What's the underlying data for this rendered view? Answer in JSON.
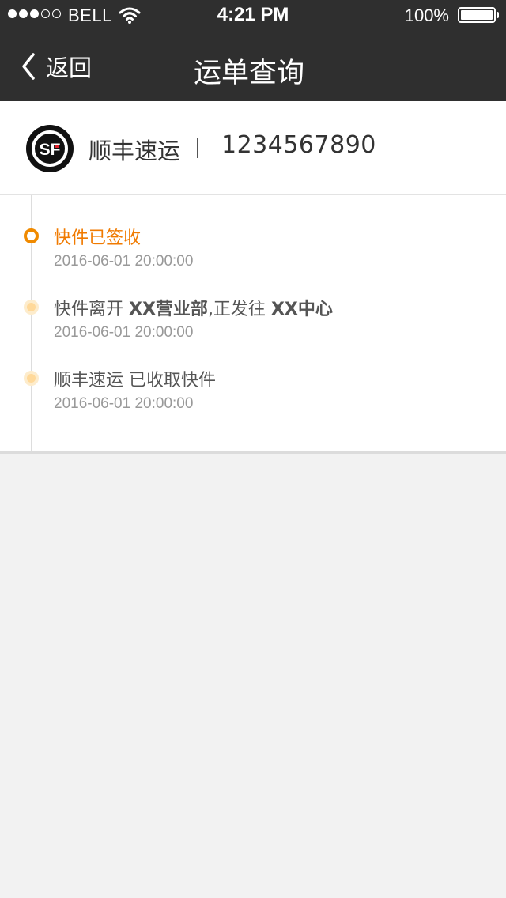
{
  "status_bar": {
    "carrier": "BELL",
    "time": "4:21 PM",
    "battery": "100%",
    "signal_dots_filled": 3,
    "signal_dots_total": 5
  },
  "nav": {
    "back_label": "返回",
    "title": "运单查询"
  },
  "shipment": {
    "carrier_name": "顺丰速运",
    "separator": "|",
    "tracking_number": "1234567890",
    "logo_icon": "sf-express-logo"
  },
  "events": [
    {
      "status": "current",
      "title": "快件已签收",
      "time": "2016-06-01 20:00:00"
    },
    {
      "status": "past",
      "title_prefix": "快件离开 ",
      "title_bold_1": "XX营业部",
      "title_middle": ",正发往 ",
      "title_bold_2": "XX中心",
      "time": "2016-06-01 20:00:00"
    },
    {
      "status": "past",
      "title": "顺丰速运 已收取快件",
      "time": "2016-06-01 20:00:00"
    }
  ],
  "colors": {
    "nav_bg": "#2f2f2f",
    "accent_orange": "#f07a00",
    "past_dot": "#ffd99a",
    "page_bg": "#f2f2f2"
  }
}
